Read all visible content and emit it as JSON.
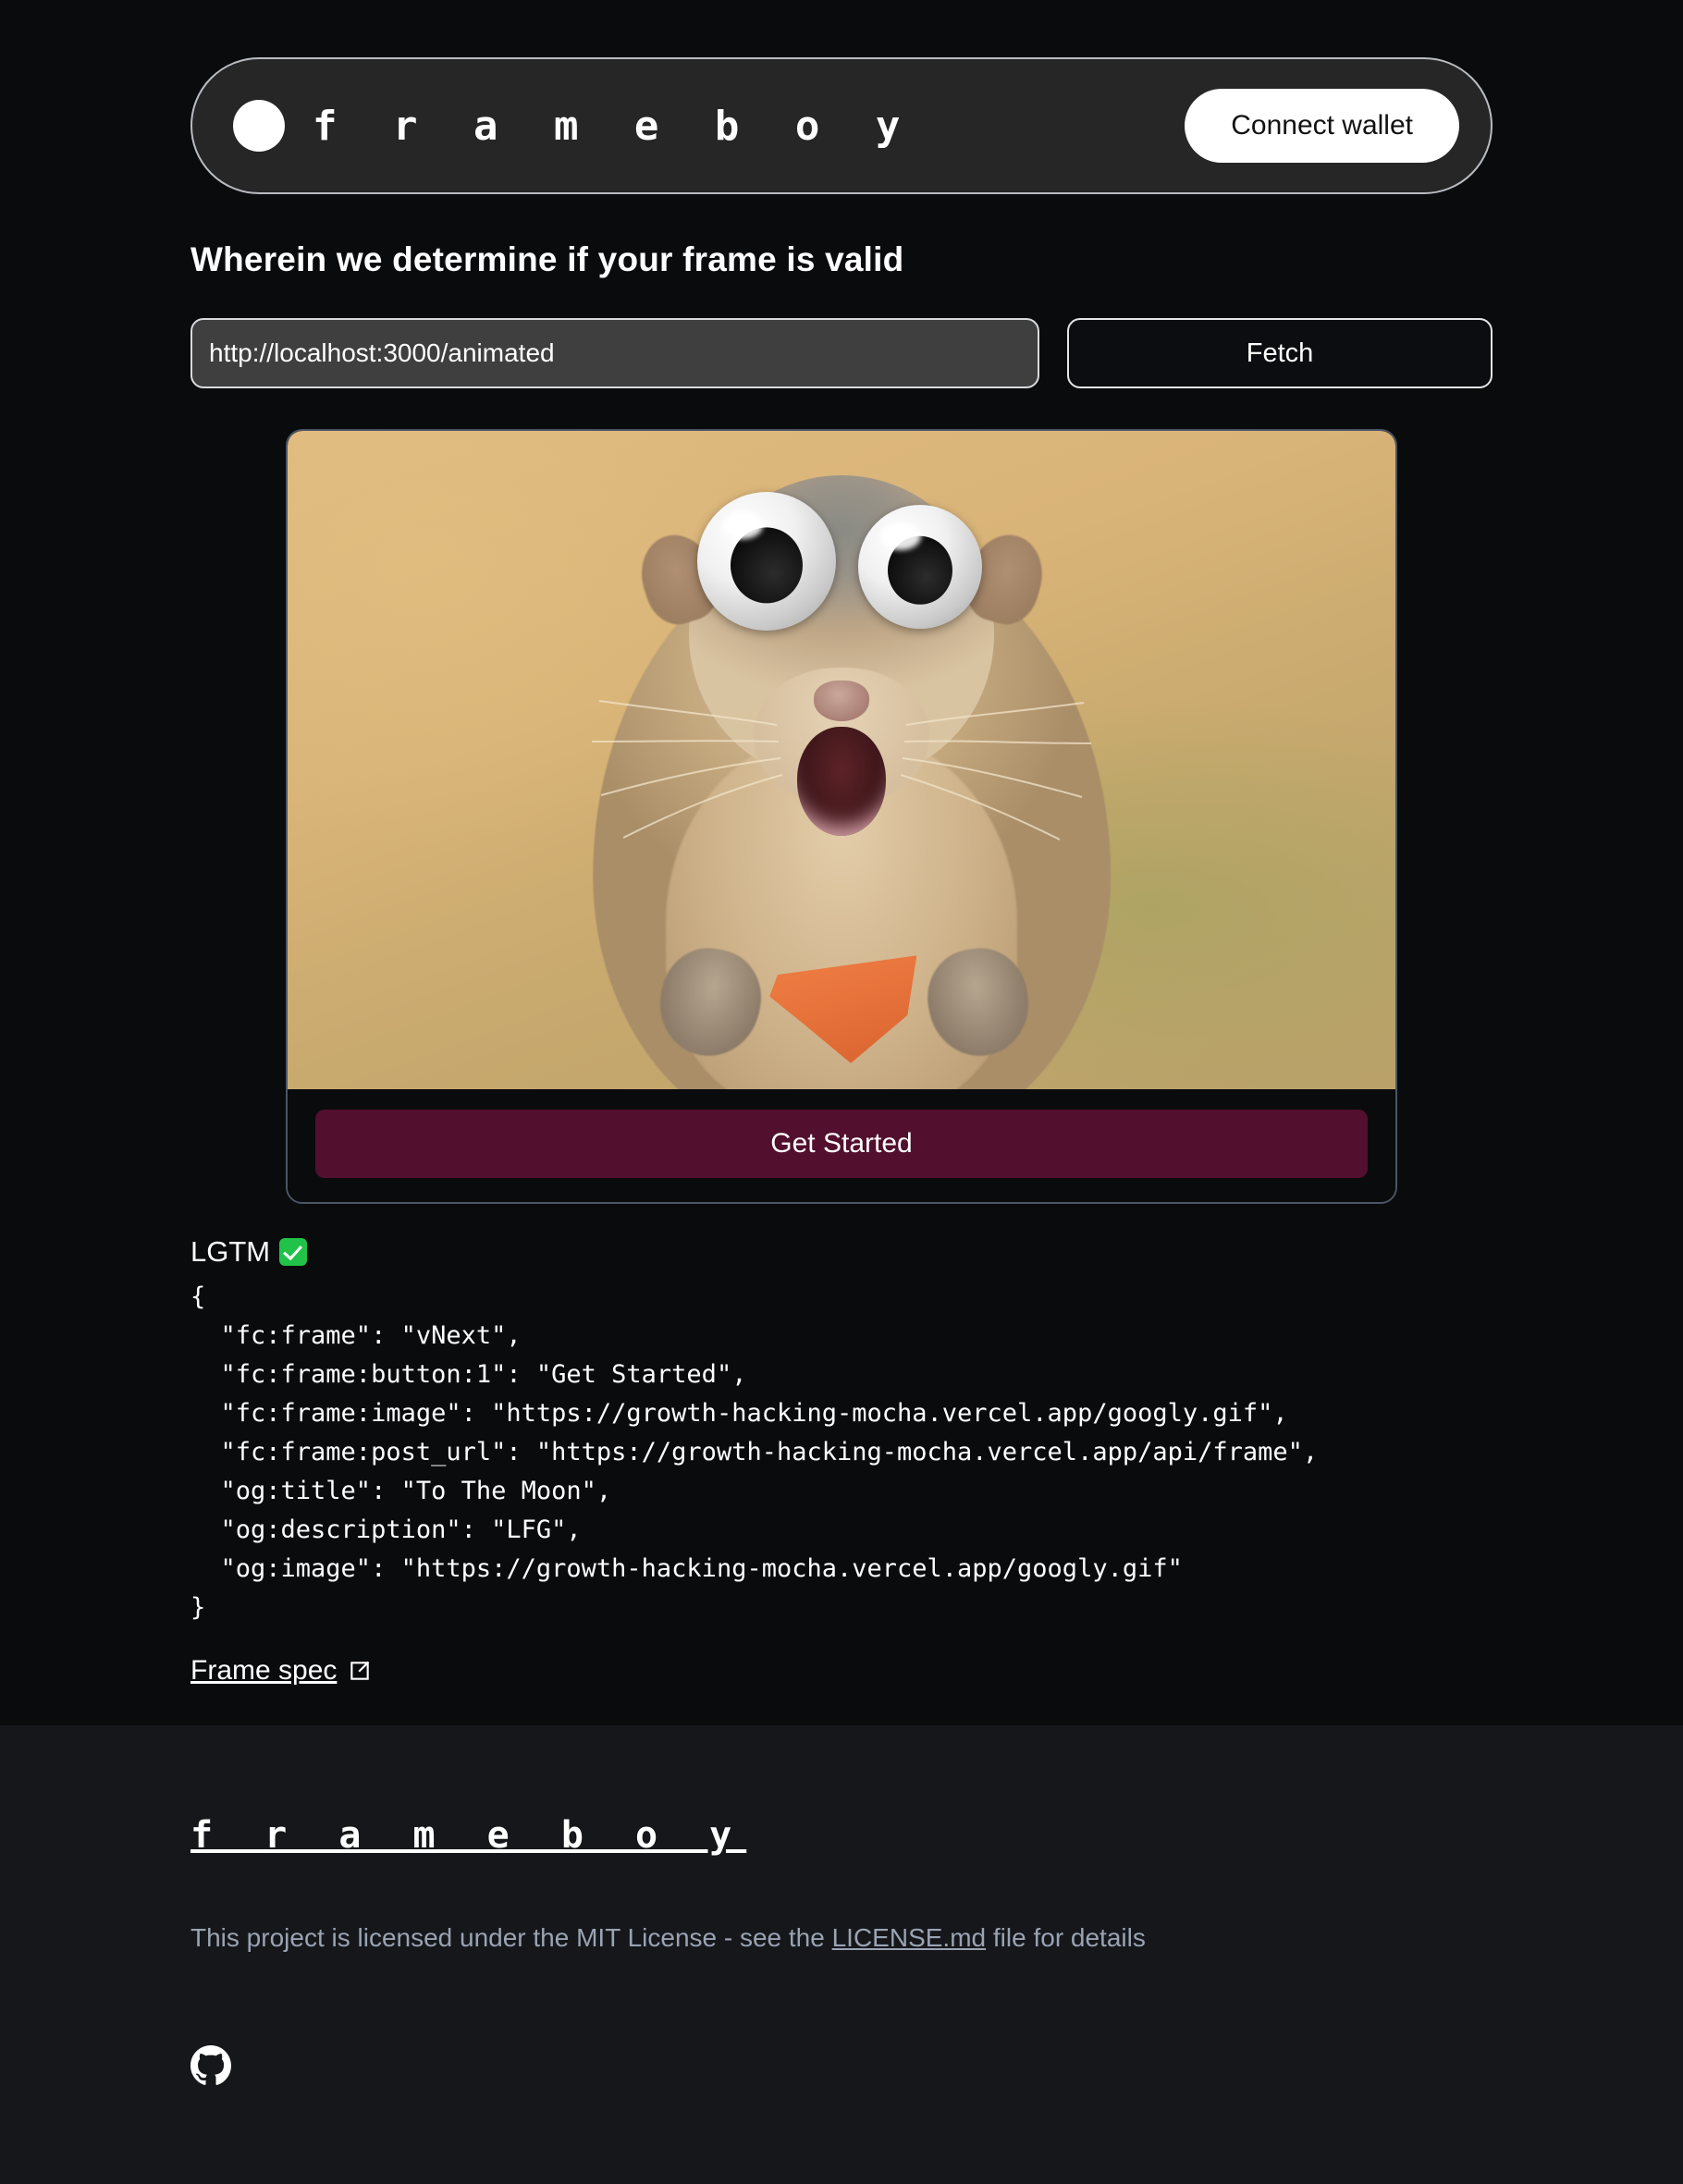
{
  "nav": {
    "logo_icon": "circle-logo-icon",
    "brand": "f r a m e b o y",
    "connect_label": "Connect wallet"
  },
  "headline": "Wherein we determine if your frame is valid",
  "form": {
    "url_value": "http://localhost:3000/animated",
    "url_placeholder": "http://localhost:3000/animated",
    "fetch_label": "Fetch"
  },
  "frame_preview": {
    "image_alt": "googly-eyed squirrel holding a carrot",
    "button_label": "Get Started"
  },
  "result": {
    "status": "LGTM",
    "status_icon": "green-check-emoji",
    "code": "{\n  \"fc:frame\": \"vNext\",\n  \"fc:frame:button:1\": \"Get Started\",\n  \"fc:frame:image\": \"https://growth-hacking-mocha.vercel.app/googly.gif\",\n  \"fc:frame:post_url\": \"https://growth-hacking-mocha.vercel.app/api/frame\",\n  \"og:title\": \"To The Moon\",\n  \"og:description\": \"LFG\",\n  \"og:image\": \"https://growth-hacking-mocha.vercel.app/googly.gif\"\n}",
    "spec_link_label": "Frame spec",
    "spec_link_icon": "external-link-icon"
  },
  "footer": {
    "brand": "f r a m e b o y",
    "license_prefix": "This project is licensed under the MIT License - see the ",
    "license_link": "LICENSE.md",
    "license_suffix": " file for details",
    "github_icon": "github-icon"
  },
  "colors": {
    "page_bg": "#0a0b0d",
    "footer_bg": "#15171b",
    "nav_bg": "#262626",
    "accent_button": "#520f2e",
    "input_bg": "#3f3f3f",
    "muted_text": "#9aa3b2",
    "success": "#21c24a"
  }
}
